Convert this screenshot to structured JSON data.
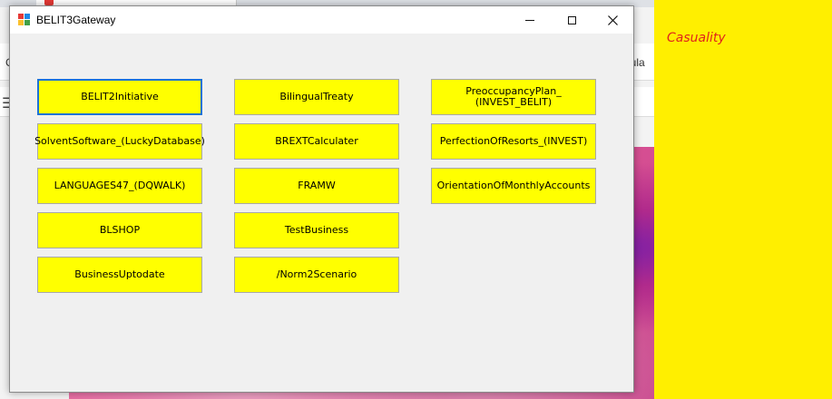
{
  "window": {
    "title": "BELIT3Gateway"
  },
  "background": {
    "side_panel_text": "Casuality",
    "side_panel_color": "#ffef00",
    "side_panel_text_color": "#e0241b",
    "browser_partial_text_right": "icula",
    "browser_partial_text_left": "C",
    "hamburger_glyph": "☰"
  },
  "colors": {
    "button_fill": "#ffff00",
    "focus_border": "#1e73d6"
  },
  "buttons": {
    "col1": [
      "BELIT2Initiative",
      "SolventSoftware_(LuckyDatabase)",
      "LANGUAGES47_(DQWALK)",
      "BLSHOP",
      "BusinessUptodate"
    ],
    "col2": [
      "BilingualTreaty",
      "BREXTCalculater",
      "FRAMW",
      "TestBusiness",
      "/Norm2Scenario"
    ],
    "col3": [
      "PreoccupancyPlan_\n(INVEST_BELIT)",
      "PerfectionOfResorts_(INVEST)",
      "OrientationOfMonthlyAccounts"
    ]
  }
}
